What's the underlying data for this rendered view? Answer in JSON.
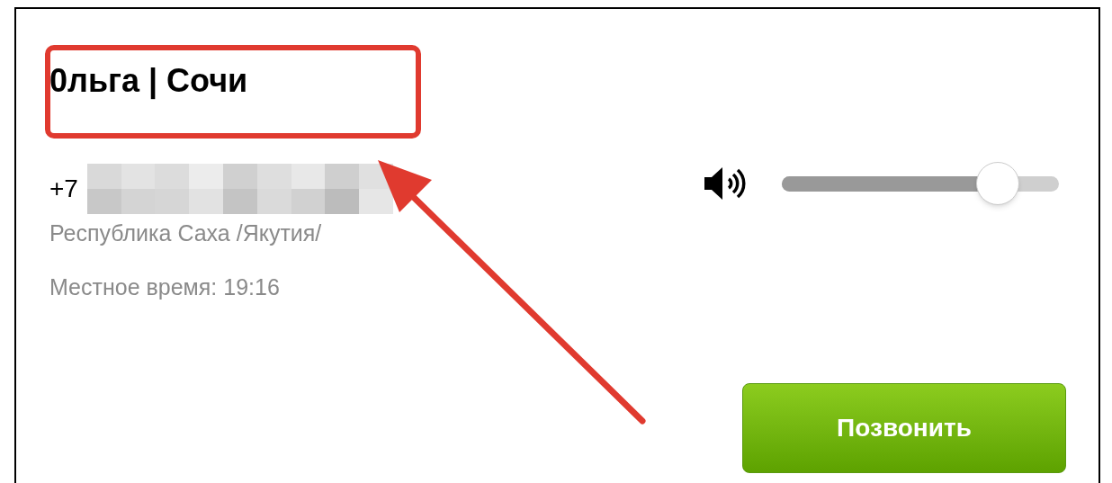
{
  "contact": {
    "title": "0льга | Сочи",
    "phone_prefix": "+7",
    "region": "Республика Саха /Якутия/",
    "local_time": "Местное время: 19:16"
  },
  "volume": {
    "level": 0.78
  },
  "call_button": {
    "label": "Позвонить"
  },
  "annotations": {
    "highlight_box": true,
    "arrow": true
  }
}
